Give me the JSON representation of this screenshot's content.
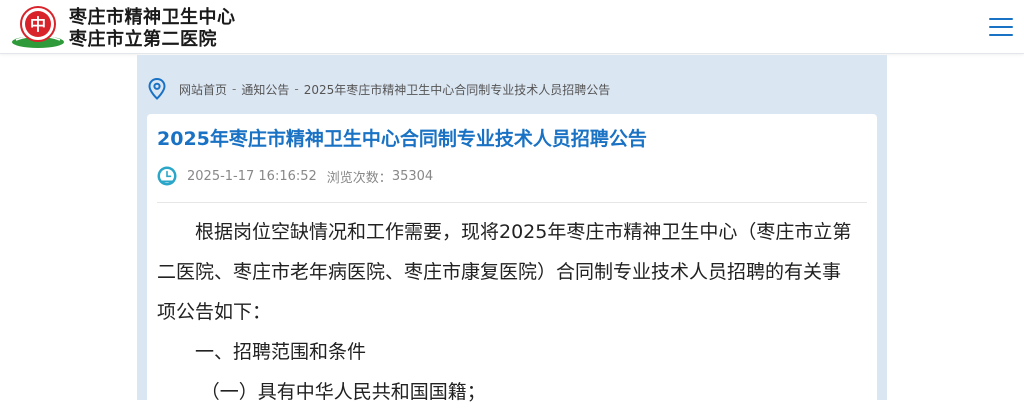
{
  "header": {
    "logo_line1": "枣庄市精神卫生中心",
    "logo_line2": "枣庄市立第二医院",
    "logo_badge": "中"
  },
  "breadcrumb": {
    "items": [
      "网站首页",
      "通知公告",
      "2025年枣庄市精神卫生中心合同制专业技术人员招聘公告"
    ],
    "separator": "-"
  },
  "article": {
    "title": "2025年枣庄市精神卫生中心合同制专业技术人员招聘公告",
    "date": "2025-1-17 16:16:52",
    "views_label": "浏览次数：",
    "views": "35304",
    "paragraphs": [
      "根据岗位空缺情况和工作需要，现将2025年枣庄市精神卫生中心（枣庄市立第二医院、枣庄市老年病医院、枣庄市康复医院）合同制专业技术人员招聘的有关事项公告如下：",
      "一、招聘范围和条件",
      "（一）具有中华人民共和国国籍；"
    ]
  },
  "colors": {
    "accent": "#1a72c4",
    "content_bg": "#dbe6f3",
    "logo_red": "#d9232b",
    "logo_green": "#2f9a3a"
  }
}
